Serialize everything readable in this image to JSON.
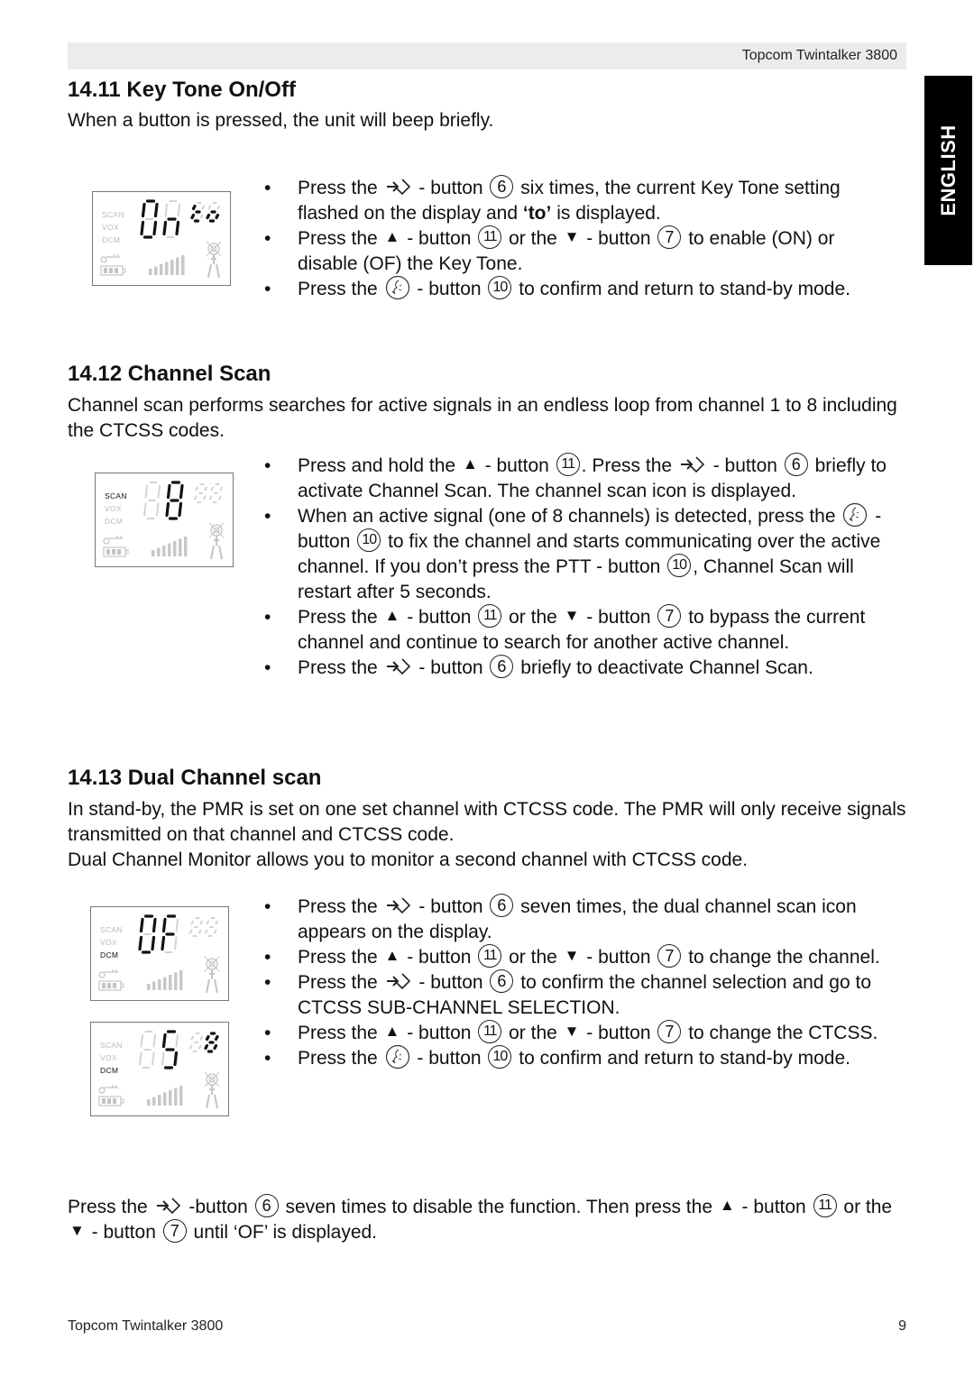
{
  "header": {
    "title": "Topcom Twintalker 3800"
  },
  "language_tab": "ENGLISH",
  "sections": [
    {
      "heading": "14.11 Key Tone On/Off",
      "intro": [
        "When a button is pressed, the unit will beep briefly."
      ],
      "display": {
        "labels": [
          "SCAN",
          "VOX",
          "DCM"
        ],
        "active_label": null,
        "main_digits": "On",
        "small_digits": "to"
      },
      "bullets": [
        [
          {
            "t": "Press the "
          },
          {
            "icon": "menu-button-icon"
          },
          {
            "t": " - button "
          },
          {
            "circ": "6"
          },
          {
            "t": " six times, the current Key Tone setting flashed on the display and "
          },
          {
            "b": "‘to’"
          },
          {
            "t": " is displayed."
          }
        ],
        [
          {
            "t": "Press the "
          },
          {
            "icon": "up-triangle-icon"
          },
          {
            "t": " - button "
          },
          {
            "circ": "11"
          },
          {
            "t": " or the "
          },
          {
            "icon": "down-triangle-icon"
          },
          {
            "t": " - button "
          },
          {
            "circ": "7"
          },
          {
            "t": " to enable (ON) or disable (OF) the Key Tone."
          }
        ],
        [
          {
            "t": "Press the "
          },
          {
            "icon": "ptt-button-icon"
          },
          {
            "t": " - button "
          },
          {
            "circ": "10"
          },
          {
            "t": " to confirm and return to stand-by mode."
          }
        ]
      ]
    },
    {
      "heading": "14.12 Channel Scan",
      "intro": [
        "Channel scan performs searches for active signals in an endless loop from channel 1 to 8 including the CTCSS codes."
      ],
      "display": {
        "labels": [
          "SCAN",
          "VOX",
          "DCM"
        ],
        "active_label": "SCAN",
        "main_digits": "8",
        "small_digits": ""
      },
      "bullets": [
        [
          {
            "t": "Press and hold the "
          },
          {
            "icon": "up-triangle-icon"
          },
          {
            "t": " - button "
          },
          {
            "circ": "11"
          },
          {
            "t": ". Press the "
          },
          {
            "icon": "menu-button-icon"
          },
          {
            "t": " - button "
          },
          {
            "circ": "6"
          },
          {
            "t": " briefly to activate Channel Scan. The channel scan icon is displayed."
          }
        ],
        [
          {
            "t": "When an active signal (one of 8 channels) is detected, press the "
          },
          {
            "icon": "ptt-button-icon"
          },
          {
            "t": " - button "
          },
          {
            "circ": "10"
          },
          {
            "t": " to fix the channel and starts communicating over the active channel. If you don’t press the PTT - button "
          },
          {
            "circ": "10"
          },
          {
            "t": ", Channel Scan will restart after 5 seconds."
          }
        ],
        [
          {
            "t": "Press the "
          },
          {
            "icon": "up-triangle-icon"
          },
          {
            "t": " - button "
          },
          {
            "circ": "11"
          },
          {
            "t": " or the "
          },
          {
            "icon": "down-triangle-icon"
          },
          {
            "t": " - button "
          },
          {
            "circ": "7"
          },
          {
            "t": " to bypass the current channel and continue to search for another active channel."
          }
        ],
        [
          {
            "t": "Press the "
          },
          {
            "icon": "menu-button-icon"
          },
          {
            "t": " - button "
          },
          {
            "circ": "6"
          },
          {
            "t": " briefly to deactivate Channel Scan."
          }
        ]
      ]
    },
    {
      "heading": "14.13 Dual Channel scan",
      "intro": [
        "In stand-by, the PMR is set on one set channel with CTCSS code. The PMR will only receive signals transmitted on that channel and CTCSS code.",
        "Dual Channel Monitor allows you to monitor a second channel with CTCSS code."
      ],
      "displays": [
        {
          "labels": [
            "SCAN",
            "VOX",
            "DCM"
          ],
          "active_label": "DCM",
          "main_digits": "OF",
          "small_digits": ""
        },
        {
          "labels": [
            "SCAN",
            "VOX",
            "DCM"
          ],
          "active_label": "DCM",
          "main_digits": "5",
          "small_digits": "8"
        }
      ],
      "bullets": [
        [
          {
            "t": "Press the "
          },
          {
            "icon": "menu-button-icon"
          },
          {
            "t": " - button "
          },
          {
            "circ": "6"
          },
          {
            "t": " seven times, the dual channel scan icon appears on the display."
          }
        ],
        [
          {
            "t": "Press the "
          },
          {
            "icon": "up-triangle-icon"
          },
          {
            "t": " - button "
          },
          {
            "circ": "11"
          },
          {
            "t": " or the "
          },
          {
            "icon": "down-triangle-icon"
          },
          {
            "t": " - button "
          },
          {
            "circ": "7"
          },
          {
            "t": " to change the channel."
          }
        ],
        [
          {
            "t": "Press the "
          },
          {
            "icon": "menu-button-icon"
          },
          {
            "t": " - button "
          },
          {
            "circ": "6"
          },
          {
            "t": " to confirm the channel selection and go to CTCSS SUB-CHANNEL SELECTION."
          }
        ],
        [
          {
            "t": "Press the "
          },
          {
            "icon": "up-triangle-icon"
          },
          {
            "t": " - button "
          },
          {
            "circ": "11"
          },
          {
            "t": " or the "
          },
          {
            "icon": "down-triangle-icon"
          },
          {
            "t": " - button "
          },
          {
            "circ": "7"
          },
          {
            "t": " to change the CTCSS."
          }
        ],
        [
          {
            "t": "Press the "
          },
          {
            "icon": "ptt-button-icon"
          },
          {
            "t": " - button "
          },
          {
            "circ": "10"
          },
          {
            "t": " to confirm and return to stand-by mode."
          }
        ]
      ],
      "closing": [
        {
          "t": "Press the "
        },
        {
          "icon": "menu-button-icon"
        },
        {
          "t": " -button "
        },
        {
          "circ": "6"
        },
        {
          "t": " seven times to disable the function. Then press the "
        },
        {
          "icon": "up-triangle-icon"
        },
        {
          "t": " - button "
        },
        {
          "circ": "11"
        },
        {
          "t": " or the "
        },
        {
          "icon": "down-triangle-icon"
        },
        {
          "t": " - button "
        },
        {
          "circ": "7"
        },
        {
          "t": " until ‘OF’ is displayed."
        }
      ]
    }
  ],
  "footer": {
    "left": "Topcom Twintalker 3800",
    "page_number": "9"
  }
}
